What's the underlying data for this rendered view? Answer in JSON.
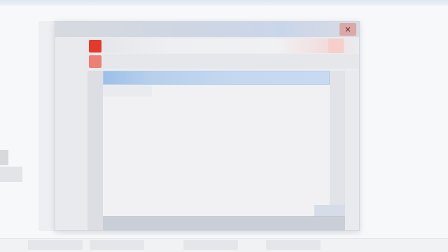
{
  "window": {
    "title": "",
    "close_glyph": "✕"
  },
  "list": {
    "selected_item": ""
  },
  "colors": {
    "accent_red": "#e23b2e",
    "selection_blue": "#c5d8f0",
    "title_bar": "#cfd6e2"
  },
  "icons": {
    "app": "app-icon",
    "close": "close-icon"
  }
}
